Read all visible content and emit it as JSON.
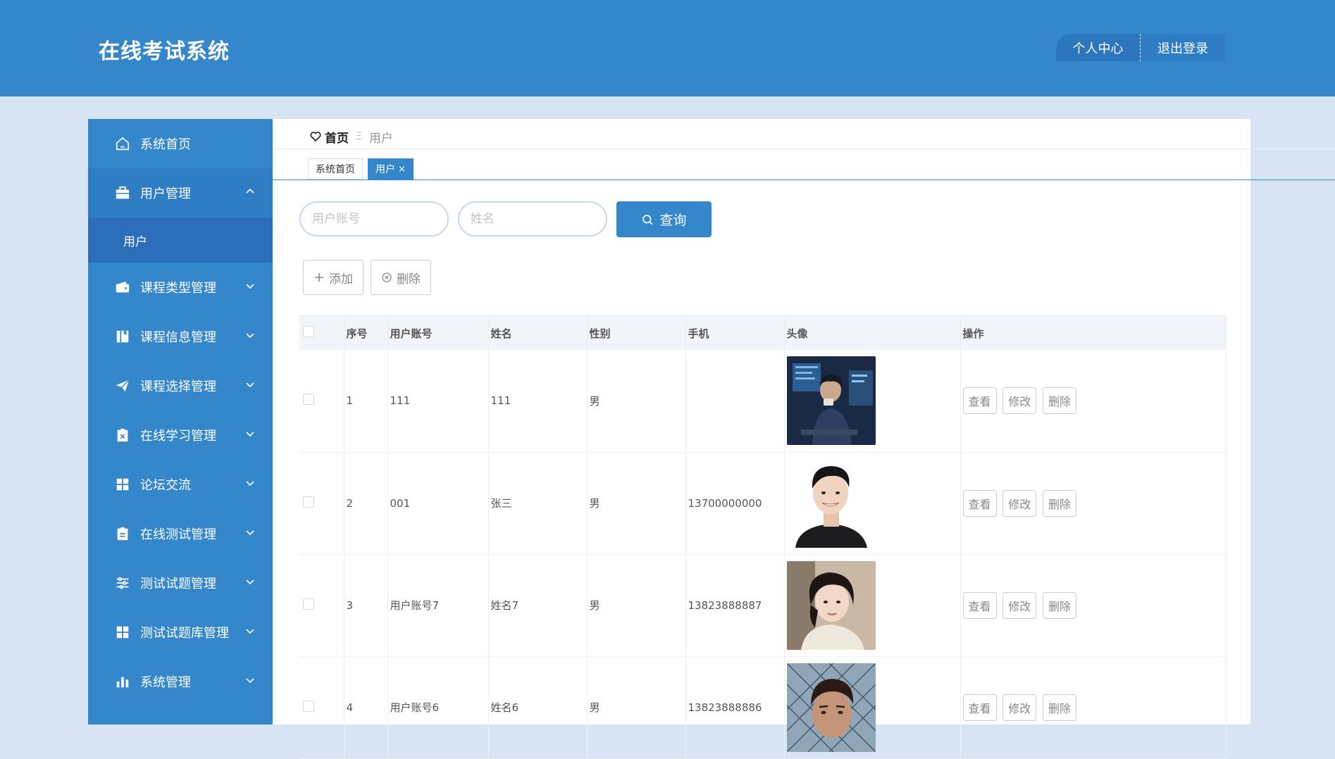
{
  "header": {
    "title": "在线考试系统",
    "profile_label": "个人中心",
    "logout_label": "退出登录"
  },
  "sidebar": {
    "items": [
      {
        "label": "系统首页",
        "icon": "home-icon"
      },
      {
        "label": "用户管理",
        "icon": "briefcase-icon",
        "expanded": true
      },
      {
        "label": "课程类型管理",
        "icon": "wallet-icon"
      },
      {
        "label": "课程信息管理",
        "icon": "book-icon"
      },
      {
        "label": "课程选择管理",
        "icon": "paper-plane-icon"
      },
      {
        "label": "在线学习管理",
        "icon": "clipboard-x-icon"
      },
      {
        "label": "论坛交流",
        "icon": "grid-icon"
      },
      {
        "label": "在线测试管理",
        "icon": "clipboard-icon"
      },
      {
        "label": "测试试题管理",
        "icon": "sliders-icon"
      },
      {
        "label": "测试试题库管理",
        "icon": "grid-icon"
      },
      {
        "label": "系统管理",
        "icon": "bar-chart-icon"
      }
    ],
    "submenu": [
      "用户"
    ]
  },
  "breadcrumb": {
    "home": "首页",
    "separator": "Ξ",
    "current": "用户"
  },
  "tabs": [
    {
      "label": "系统首页",
      "active": false
    },
    {
      "label": "用户",
      "active": true,
      "close": "×"
    }
  ],
  "search": {
    "account_placeholder": "用户账号",
    "name_placeholder": "姓名",
    "button_label": "查询"
  },
  "actions": {
    "add_label": "添加",
    "delete_label": "删除"
  },
  "table": {
    "columns": [
      "序号",
      "用户账号",
      "姓名",
      "性别",
      "手机",
      "头像",
      "操作"
    ],
    "rows": [
      {
        "index": "1",
        "account": "111",
        "name": "111",
        "gender": "男",
        "phone": "",
        "avatar": "avatar-coder"
      },
      {
        "index": "2",
        "account": "001",
        "name": "张三",
        "gender": "男",
        "phone": "13700000000",
        "avatar": "avatar-man-smile"
      },
      {
        "index": "3",
        "account": "用户账号7",
        "name": "姓名7",
        "gender": "男",
        "phone": "13823888887",
        "avatar": "avatar-girl"
      },
      {
        "index": "4",
        "account": "用户账号6",
        "name": "姓名6",
        "gender": "男",
        "phone": "13823888886",
        "avatar": "avatar-man-fence"
      }
    ],
    "row_actions": {
      "view": "查看",
      "edit": "修改",
      "delete": "删除"
    }
  },
  "colors": {
    "primary": "#3587cb",
    "sidebar_open": "#2f7dc4",
    "submenu": "#2d6ebb",
    "page_bg": "#d6e4f3"
  }
}
